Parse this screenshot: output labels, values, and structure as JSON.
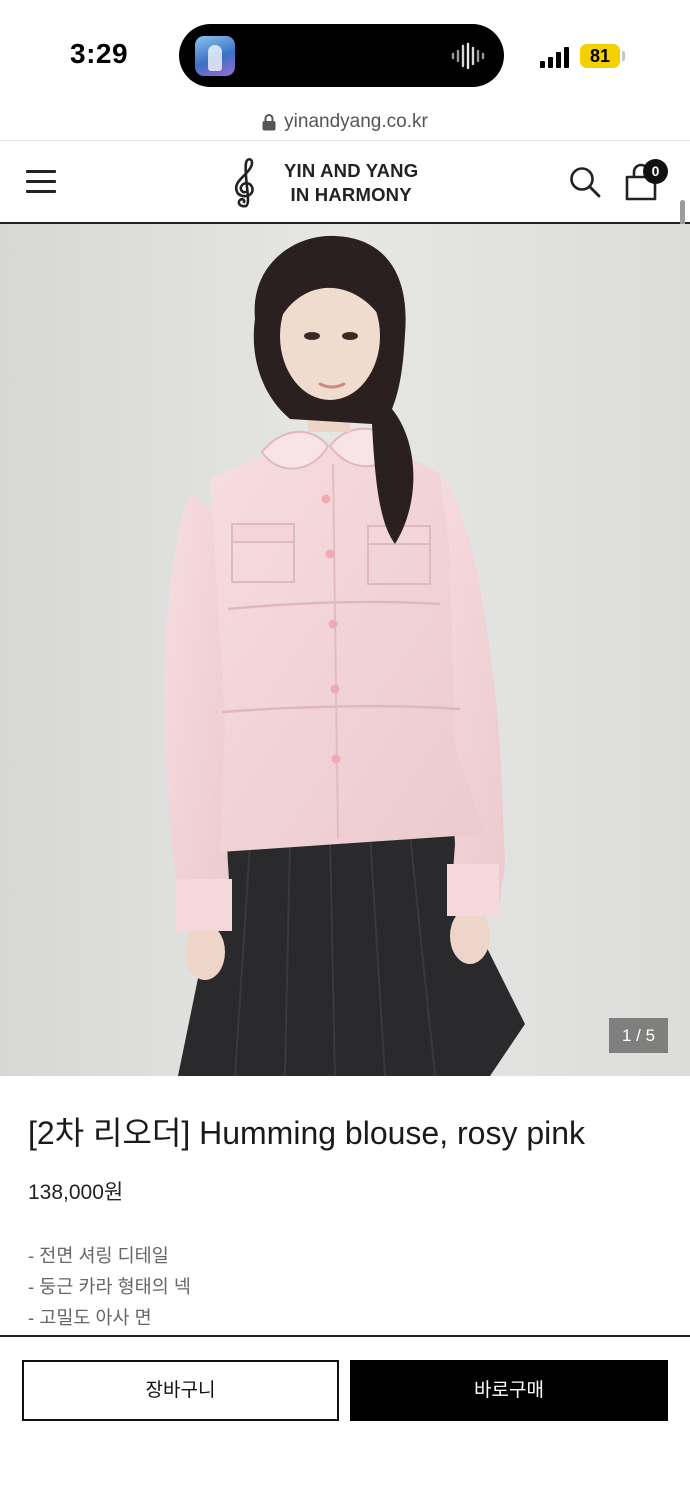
{
  "status_bar": {
    "time": "3:29",
    "battery": "81",
    "colors": {
      "battery": "#f5d000"
    }
  },
  "url_bar": {
    "url": "yinandyang.co.kr",
    "icon": "lock-icon"
  },
  "header": {
    "menu_icon": "hamburger-menu-icon",
    "brand_line1": "YIN AND YANG",
    "brand_line2": "IN HARMONY",
    "logo_icon": "treble-clef-icon",
    "search_icon": "search-icon",
    "cart_icon": "shopping-bag-icon",
    "cart_count": "0"
  },
  "gallery": {
    "counter": "1 / 5",
    "current_index": 1,
    "total": 5
  },
  "product": {
    "title": "[2차 리오더] Humming blouse, rosy pink",
    "price": "138,000원",
    "features": [
      "- 전면 셔링 디테일",
      "- 둥근 카라 형태의 넥",
      "- 고밀도 아사 면"
    ]
  },
  "actions": {
    "add_to_cart": "장바구니",
    "buy_now": "바로구매"
  }
}
